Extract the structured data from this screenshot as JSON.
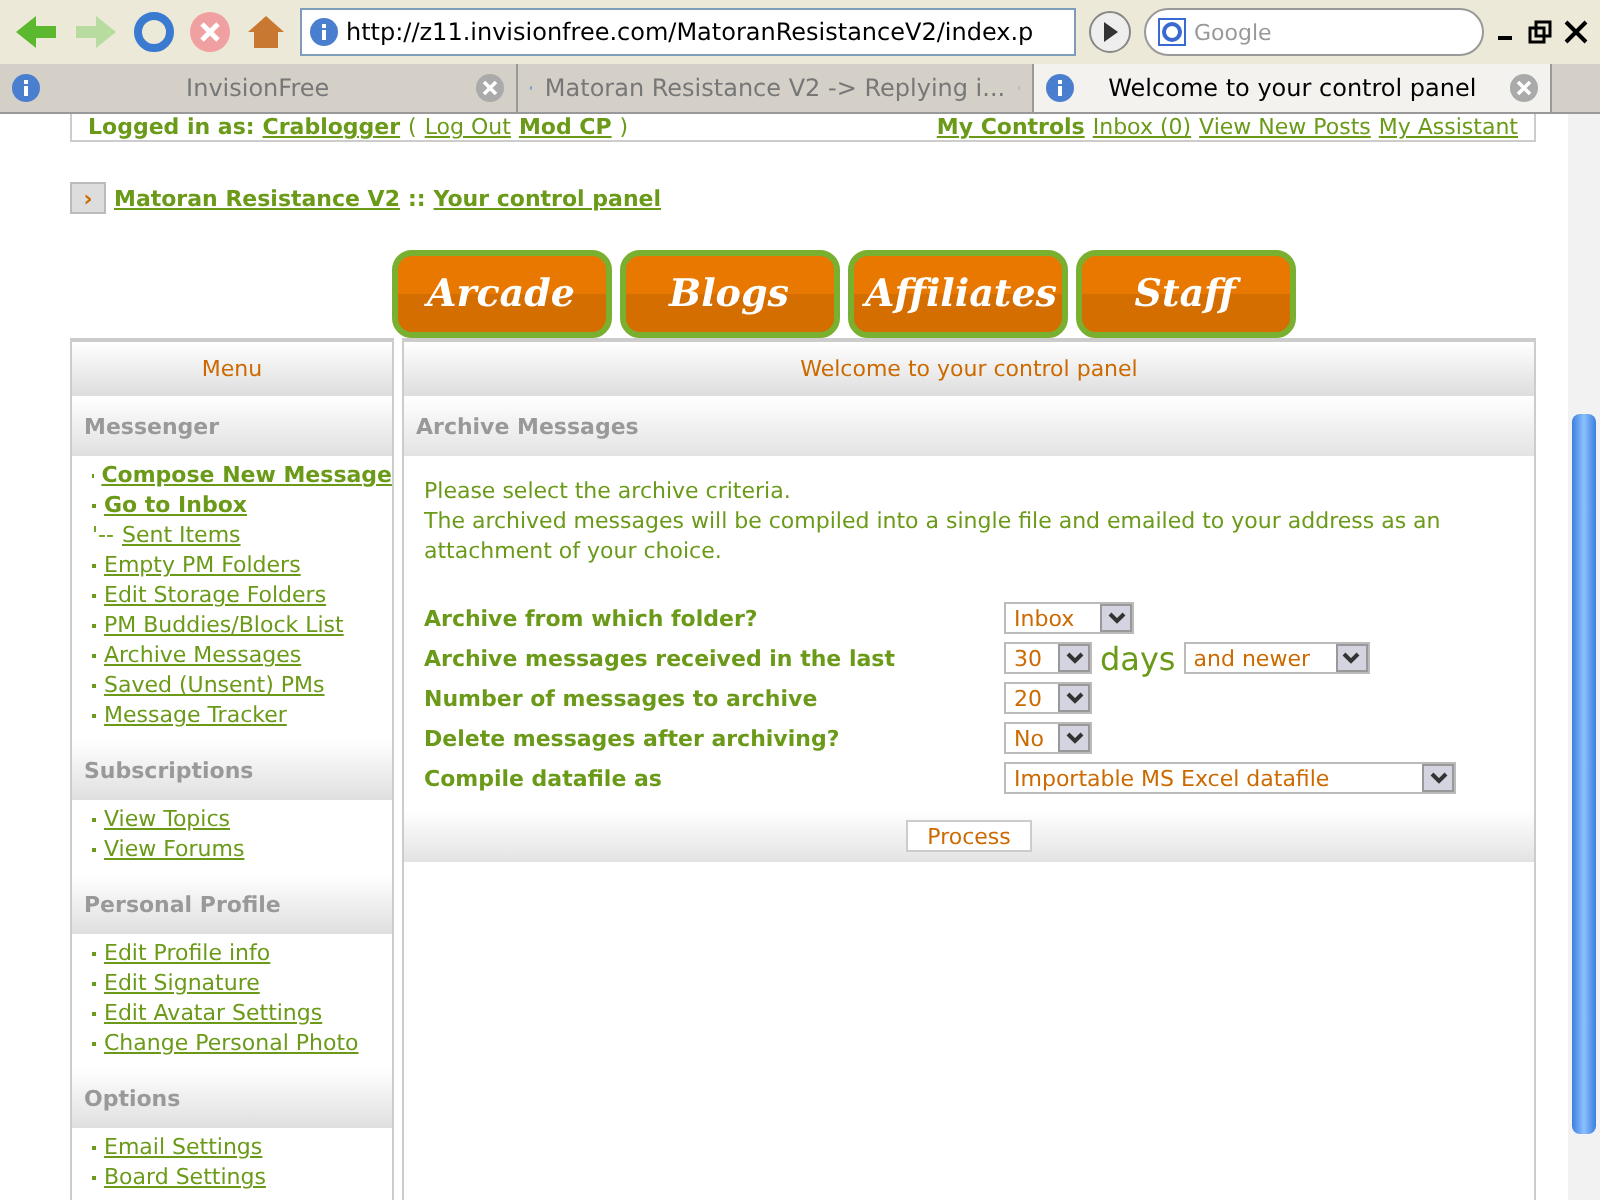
{
  "browser": {
    "url": "http://z11.invisionfree.com/MatoranResistanceV2/index.p",
    "search_placeholder": "Google"
  },
  "tabs": [
    {
      "label": "InvisionFree",
      "selected": false
    },
    {
      "label": "Matoran Resistance V2 -> Replying i...",
      "selected": false
    },
    {
      "label": "Welcome to your control panel",
      "selected": true
    }
  ],
  "userbar": {
    "prefix": "Logged in as:",
    "user": "Crablogger",
    "open": "(",
    "links_left": [
      "Log Out",
      "Mod CP"
    ],
    "close": ")",
    "links_right": [
      "My Controls",
      "Inbox (0)",
      "View New Posts",
      "My Assistant"
    ]
  },
  "breadcrumb": {
    "arrow": "›",
    "board": "Matoran Resistance V2",
    "sep": "::",
    "page": "Your control panel"
  },
  "nav_buttons": [
    "Arcade",
    "Blogs",
    "Affiliates",
    "Staff"
  ],
  "sidebar": {
    "title": "Menu",
    "sections": [
      {
        "title": "Messenger",
        "items": [
          {
            "label": "Compose New Message",
            "kind": "bold"
          },
          {
            "label": "Go to Inbox",
            "kind": "bold"
          },
          {
            "label": "Sent Items",
            "kind": "sub",
            "prefix": "'--"
          },
          {
            "label": "Empty PM Folders",
            "kind": "normal"
          },
          {
            "label": "Edit Storage Folders",
            "kind": "normal"
          },
          {
            "label": "PM Buddies/Block List",
            "kind": "normal"
          },
          {
            "label": "Archive Messages",
            "kind": "normal"
          },
          {
            "label": "Saved (Unsent) PMs",
            "kind": "normal"
          },
          {
            "label": "Message Tracker",
            "kind": "normal"
          }
        ]
      },
      {
        "title": "Subscriptions",
        "items": [
          {
            "label": "View Topics",
            "kind": "normal"
          },
          {
            "label": "View Forums",
            "kind": "normal"
          }
        ]
      },
      {
        "title": "Personal Profile",
        "items": [
          {
            "label": "Edit Profile info",
            "kind": "normal"
          },
          {
            "label": "Edit Signature",
            "kind": "normal"
          },
          {
            "label": "Edit Avatar Settings",
            "kind": "normal"
          },
          {
            "label": "Change Personal Photo",
            "kind": "normal"
          }
        ]
      },
      {
        "title": "Options",
        "items": [
          {
            "label": "Email Settings",
            "kind": "normal"
          },
          {
            "label": "Board Settings",
            "kind": "normal"
          }
        ]
      }
    ]
  },
  "main": {
    "title": "Welcome to your control panel",
    "section": "Archive Messages",
    "intro": [
      "Please select the archive criteria.",
      "The archived messages will be compiled into a single file and emailed to your address as an attachment of your choice."
    ],
    "rows": [
      {
        "label": "Archive from which folder?",
        "controls": [
          {
            "kind": "select",
            "value": "Inbox"
          }
        ]
      },
      {
        "label": "Archive messages received in the last",
        "controls": [
          {
            "kind": "select",
            "value": "30"
          },
          {
            "kind": "text",
            "value": "days"
          },
          {
            "kind": "select",
            "value": "and newer"
          }
        ]
      },
      {
        "label": "Number of messages to archive",
        "controls": [
          {
            "kind": "select",
            "value": "20"
          }
        ]
      },
      {
        "label": "Delete messages after archiving?",
        "controls": [
          {
            "kind": "select",
            "value": "No"
          }
        ]
      },
      {
        "label": "Compile datafile as",
        "controls": [
          {
            "kind": "select",
            "value": "Importable MS Excel datafile"
          }
        ]
      }
    ],
    "submit": "Process"
  }
}
